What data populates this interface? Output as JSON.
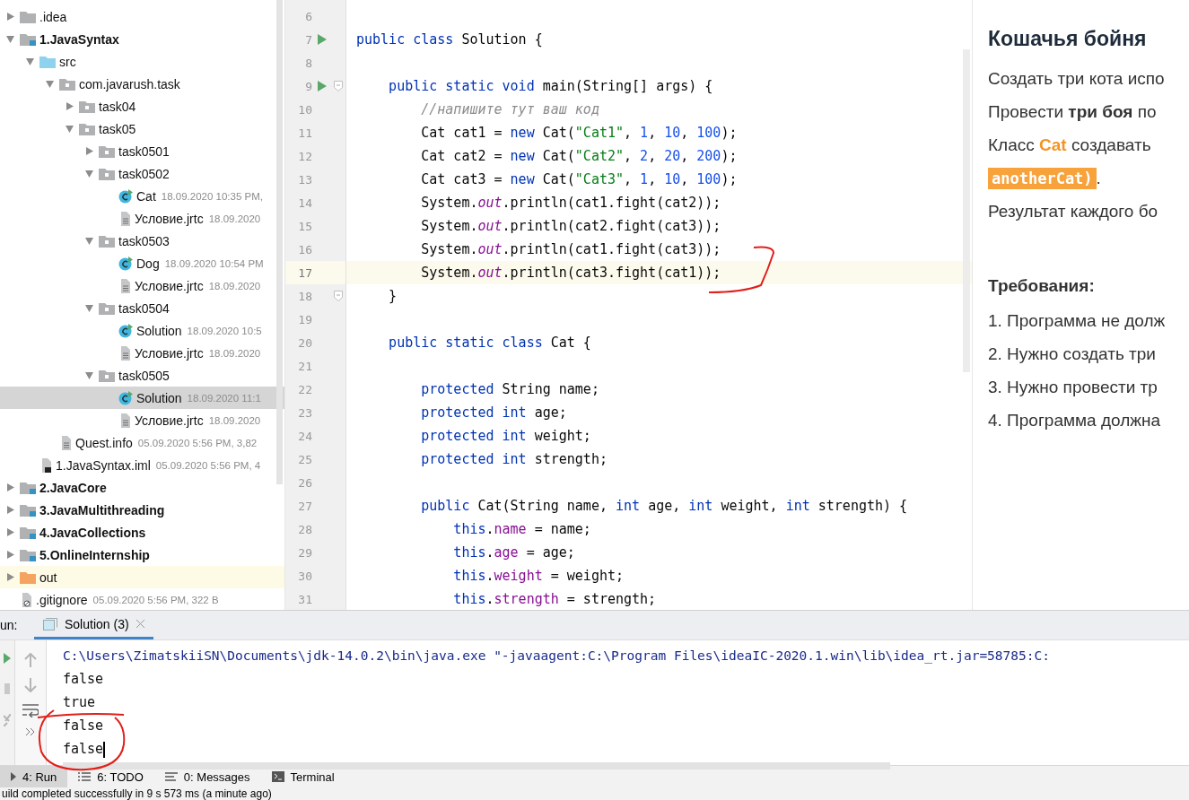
{
  "project_tree": [
    {
      "name": ".idea",
      "kind": "folder",
      "expanded": false,
      "selected": false
    },
    {
      "name": "1.JavaSyntax",
      "kind": "module",
      "expanded": true,
      "selected": false,
      "children": [
        {
          "name": "src",
          "kind": "source",
          "expanded": true,
          "selected": false,
          "children": [
            {
              "name": "com.javarush.task",
              "kind": "package",
              "expanded": true,
              "selected": false,
              "children": [
                {
                  "name": "task04",
                  "kind": "package",
                  "expanded": false,
                  "selected": false
                },
                {
                  "name": "task05",
                  "kind": "package",
                  "expanded": true,
                  "selected": false,
                  "children": [
                    {
                      "name": "task0501",
                      "kind": "package",
                      "expanded": false,
                      "selected": false
                    },
                    {
                      "name": "task0502",
                      "kind": "package",
                      "expanded": true,
                      "selected": false,
                      "children": [
                        {
                          "name": "Cat",
                          "detail": "18.09.2020 10:35 PM,",
                          "kind": "class",
                          "selected": false
                        },
                        {
                          "name": "Условие.jrtc",
                          "detail": "18.09.2020",
                          "kind": "file",
                          "selected": false
                        }
                      ]
                    },
                    {
                      "name": "task0503",
                      "kind": "package",
                      "expanded": true,
                      "selected": false,
                      "children": [
                        {
                          "name": "Dog",
                          "detail": "18.09.2020 10:54 PM",
                          "kind": "class",
                          "selected": false
                        },
                        {
                          "name": "Условие.jrtc",
                          "detail": "18.09.2020",
                          "kind": "file",
                          "selected": false
                        }
                      ]
                    },
                    {
                      "name": "task0504",
                      "kind": "package",
                      "expanded": true,
                      "selected": false,
                      "children": [
                        {
                          "name": "Solution",
                          "detail": "18.09.2020 10:5",
                          "kind": "class",
                          "selected": false
                        },
                        {
                          "name": "Условие.jrtc",
                          "detail": "18.09.2020",
                          "kind": "file",
                          "selected": false
                        }
                      ]
                    },
                    {
                      "name": "task0505",
                      "kind": "package",
                      "expanded": true,
                      "selected": false,
                      "children": [
                        {
                          "name": "Solution",
                          "detail": "18.09.2020 11:1",
                          "kind": "class",
                          "selected": true
                        },
                        {
                          "name": "Условие.jrtc",
                          "detail": "18.09.2020",
                          "kind": "file",
                          "selected": false
                        }
                      ]
                    }
                  ]
                }
              ]
            },
            {
              "name": "Quest.info",
              "detail": "05.09.2020 5:56 PM, 3,82",
              "kind": "file",
              "selected": false
            }
          ]
        },
        {
          "name": "1.JavaSyntax.iml",
          "detail": "05.09.2020 5:56 PM, 4",
          "kind": "iml",
          "selected": false
        }
      ]
    },
    {
      "name": "2.JavaCore",
      "kind": "module",
      "expanded": false,
      "selected": false
    },
    {
      "name": "3.JavaMultithreading",
      "kind": "module",
      "expanded": false,
      "selected": false
    },
    {
      "name": "4.JavaCollections",
      "kind": "module",
      "expanded": false,
      "selected": false
    },
    {
      "name": "5.OnlineInternship",
      "kind": "module",
      "expanded": false,
      "selected": false
    },
    {
      "name": "out",
      "kind": "excluded",
      "expanded": false,
      "selected": false
    },
    {
      "name": ".gitignore",
      "detail": "05.09.2020 5:56 PM, 322 B",
      "kind": "ignore",
      "selected": false
    }
  ],
  "editor": {
    "lines": [
      {
        "number": "6",
        "current": false
      },
      {
        "number": "7",
        "current": false,
        "run": true,
        "tokens": [
          {
            "kind": "keyword",
            "text": "public class "
          },
          {
            "kind": "plain",
            "text": "Solution {"
          }
        ]
      },
      {
        "number": "8",
        "current": false
      },
      {
        "number": "9",
        "current": false,
        "run": true,
        "fold": true,
        "tokens": [
          {
            "kind": "keyword",
            "text": "    public static void "
          },
          {
            "kind": "plain",
            "text": "main(String[] args) {"
          }
        ]
      },
      {
        "number": "10",
        "current": false,
        "tokens": [
          {
            "kind": "comment",
            "text": "        //напишите тут ваш код"
          }
        ]
      },
      {
        "number": "11",
        "current": false,
        "tokens": [
          {
            "kind": "plain",
            "text": "        Cat cat1 = "
          },
          {
            "kind": "keyword",
            "text": "new "
          },
          {
            "kind": "plain",
            "text": "Cat("
          },
          {
            "kind": "string",
            "text": "\"Cat1\""
          },
          {
            "kind": "plain",
            "text": ", "
          },
          {
            "kind": "number",
            "text": "1"
          },
          {
            "kind": "plain",
            "text": ", "
          },
          {
            "kind": "number",
            "text": "10"
          },
          {
            "kind": "plain",
            "text": ", "
          },
          {
            "kind": "number",
            "text": "100"
          },
          {
            "kind": "plain",
            "text": ");"
          }
        ]
      },
      {
        "number": "12",
        "current": false,
        "tokens": [
          {
            "kind": "plain",
            "text": "        Cat cat2 = "
          },
          {
            "kind": "keyword",
            "text": "new "
          },
          {
            "kind": "plain",
            "text": "Cat("
          },
          {
            "kind": "string",
            "text": "\"Cat2\""
          },
          {
            "kind": "plain",
            "text": ", "
          },
          {
            "kind": "number",
            "text": "2"
          },
          {
            "kind": "plain",
            "text": ", "
          },
          {
            "kind": "number",
            "text": "20"
          },
          {
            "kind": "plain",
            "text": ", "
          },
          {
            "kind": "number",
            "text": "200"
          },
          {
            "kind": "plain",
            "text": ");"
          }
        ]
      },
      {
        "number": "13",
        "current": false,
        "tokens": [
          {
            "kind": "plain",
            "text": "        Cat cat3 = "
          },
          {
            "kind": "keyword",
            "text": "new "
          },
          {
            "kind": "plain",
            "text": "Cat("
          },
          {
            "kind": "string",
            "text": "\"Cat3\""
          },
          {
            "kind": "plain",
            "text": ", "
          },
          {
            "kind": "number",
            "text": "1"
          },
          {
            "kind": "plain",
            "text": ", "
          },
          {
            "kind": "number",
            "text": "10"
          },
          {
            "kind": "plain",
            "text": ", "
          },
          {
            "kind": "number",
            "text": "100"
          },
          {
            "kind": "plain",
            "text": ");"
          }
        ]
      },
      {
        "number": "14",
        "current": false,
        "tokens": [
          {
            "kind": "plain",
            "text": "        System."
          },
          {
            "kind": "static_field",
            "text": "out"
          },
          {
            "kind": "plain",
            "text": ".println(cat1.fight(cat2));"
          }
        ]
      },
      {
        "number": "15",
        "current": false,
        "tokens": [
          {
            "kind": "plain",
            "text": "        System."
          },
          {
            "kind": "static_field",
            "text": "out"
          },
          {
            "kind": "plain",
            "text": ".println(cat2.fight(cat3));"
          }
        ]
      },
      {
        "number": "16",
        "current": false,
        "tokens": [
          {
            "kind": "plain",
            "text": "        System."
          },
          {
            "kind": "static_field",
            "text": "out"
          },
          {
            "kind": "plain",
            "text": ".println(cat1.fight(cat3));"
          }
        ]
      },
      {
        "number": "17",
        "current": true,
        "tokens": [
          {
            "kind": "plain",
            "text": "        System."
          },
          {
            "kind": "static_field",
            "text": "out"
          },
          {
            "kind": "plain",
            "text": ".println(cat3.fight(cat1));"
          }
        ]
      },
      {
        "number": "18",
        "current": false,
        "fold": true,
        "tokens": [
          {
            "kind": "plain",
            "text": "    }"
          }
        ]
      },
      {
        "number": "19",
        "current": false
      },
      {
        "number": "20",
        "current": false,
        "tokens": [
          {
            "kind": "keyword",
            "text": "    public static class "
          },
          {
            "kind": "plain",
            "text": "Cat {"
          }
        ]
      },
      {
        "number": "21",
        "current": false
      },
      {
        "number": "22",
        "current": false,
        "tokens": [
          {
            "kind": "keyword",
            "text": "        protected "
          },
          {
            "kind": "plain",
            "text": "String name;"
          }
        ]
      },
      {
        "number": "23",
        "current": false,
        "tokens": [
          {
            "kind": "keyword",
            "text": "        protected int "
          },
          {
            "kind": "plain",
            "text": "age;"
          }
        ]
      },
      {
        "number": "24",
        "current": false,
        "tokens": [
          {
            "kind": "keyword",
            "text": "        protected int "
          },
          {
            "kind": "plain",
            "text": "weight;"
          }
        ]
      },
      {
        "number": "25",
        "current": false,
        "tokens": [
          {
            "kind": "keyword",
            "text": "        protected int "
          },
          {
            "kind": "plain",
            "text": "strength;"
          }
        ]
      },
      {
        "number": "26",
        "current": false
      },
      {
        "number": "27",
        "current": false,
        "tokens": [
          {
            "kind": "keyword",
            "text": "        public "
          },
          {
            "kind": "plain",
            "text": "Cat(String name, "
          },
          {
            "kind": "keyword",
            "text": "int "
          },
          {
            "kind": "plain",
            "text": "age, "
          },
          {
            "kind": "keyword",
            "text": "int "
          },
          {
            "kind": "plain",
            "text": "weight, "
          },
          {
            "kind": "keyword",
            "text": "int "
          },
          {
            "kind": "plain",
            "text": "strength) {"
          }
        ]
      },
      {
        "number": "28",
        "current": false,
        "tokens": [
          {
            "kind": "keyword",
            "text": "            this"
          },
          {
            "kind": "plain",
            "text": "."
          },
          {
            "kind": "field",
            "text": "name"
          },
          {
            "kind": "plain",
            "text": " = name;"
          }
        ]
      },
      {
        "number": "29",
        "current": false,
        "tokens": [
          {
            "kind": "keyword",
            "text": "            this"
          },
          {
            "kind": "plain",
            "text": "."
          },
          {
            "kind": "field",
            "text": "age"
          },
          {
            "kind": "plain",
            "text": " = age;"
          }
        ]
      },
      {
        "number": "30",
        "current": false,
        "tokens": [
          {
            "kind": "keyword",
            "text": "            this"
          },
          {
            "kind": "plain",
            "text": "."
          },
          {
            "kind": "field",
            "text": "weight"
          },
          {
            "kind": "plain",
            "text": " = weight;"
          }
        ]
      },
      {
        "number": "31",
        "current": false,
        "tokens": [
          {
            "kind": "keyword",
            "text": "            this"
          },
          {
            "kind": "plain",
            "text": "."
          },
          {
            "kind": "field",
            "text": "strength"
          },
          {
            "kind": "plain",
            "text": " = strength;"
          }
        ]
      }
    ]
  },
  "task_description": {
    "title": "Кошачья бойня",
    "paragraphs": [
      [
        {
          "kind": "plain",
          "text": "Создать три кота испо"
        }
      ],
      [
        {
          "kind": "plain",
          "text": "Провести "
        },
        {
          "kind": "bold",
          "text": "три боя"
        },
        {
          "kind": "plain",
          "text": " по"
        }
      ],
      [
        {
          "kind": "plain",
          "text": "Класс "
        },
        {
          "kind": "accent",
          "text": "Cat"
        },
        {
          "kind": "plain",
          "text": " создавать"
        }
      ],
      [
        {
          "kind": "code",
          "text": "anotherCat)"
        },
        {
          "kind": "plain",
          "text": "."
        }
      ],
      [
        {
          "kind": "plain",
          "text": "Результат каждого бо"
        }
      ]
    ],
    "requirements_title": "Требования:",
    "requirements": [
      "1. Программа не долж",
      "2. Нужно создать три",
      "3. Нужно провести тр",
      "4. Программа должна"
    ]
  },
  "run_panel": {
    "label": "un:",
    "tabs": [
      {
        "label": "Solution (3)",
        "selected": true
      }
    ],
    "console": [
      {
        "kind": "command",
        "text": "C:\\Users\\ZimatskiiSN\\Documents\\jdk-14.0.2\\bin\\java.exe \"-javaagent:C:\\Program Files\\ideaIC-2020.1.win\\lib\\idea_rt.jar=58785:C:"
      },
      {
        "kind": "output",
        "text": "false"
      },
      {
        "kind": "output",
        "text": "true"
      },
      {
        "kind": "output",
        "text": "false"
      },
      {
        "kind": "output",
        "text": "false"
      }
    ]
  },
  "tool_tabs": [
    {
      "label": "4: Run",
      "kind": "run",
      "selected": true
    },
    {
      "label": "6: TODO",
      "kind": "todo",
      "selected": false
    },
    {
      "label": "0: Messages",
      "kind": "messages",
      "selected": false
    },
    {
      "label": "Terminal",
      "kind": "terminal",
      "selected": false
    }
  ],
  "status_bar": "uild completed successfully in 9 s 573 ms (a minute ago)"
}
